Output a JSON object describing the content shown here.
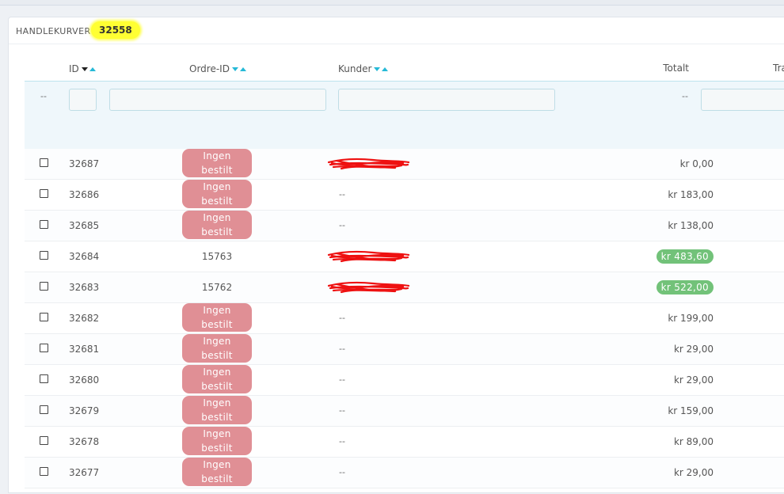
{
  "panel": {
    "title": "HANDLEKURVER",
    "count": "32558"
  },
  "columns": {
    "id": "ID",
    "order_id": "Ordre-ID",
    "customer": "Kunder",
    "total": "Totalt",
    "carrier_partial": "Tra"
  },
  "filters": {
    "bulk_placeholder": "--",
    "total_placeholder": "--",
    "id_value": "",
    "order_value": "",
    "customer_value": "",
    "carrier_value": ""
  },
  "rows": [
    {
      "id": "32687",
      "order": "Ingen bestilt",
      "order_is_badge": true,
      "customer": "",
      "customer_redacted": true,
      "total": "kr 0,00",
      "total_is_badge": false
    },
    {
      "id": "32686",
      "order": "Ingen bestilt",
      "order_is_badge": true,
      "customer": "--",
      "customer_redacted": false,
      "total": "kr 183,00",
      "total_is_badge": false
    },
    {
      "id": "32685",
      "order": "Ingen bestilt",
      "order_is_badge": true,
      "customer": "--",
      "customer_redacted": false,
      "total": "kr 138,00",
      "total_is_badge": false
    },
    {
      "id": "32684",
      "order": "15763",
      "order_is_badge": false,
      "customer": "",
      "customer_redacted": true,
      "total": "kr 483,60",
      "total_is_badge": true
    },
    {
      "id": "32683",
      "order": "15762",
      "order_is_badge": false,
      "customer": "",
      "customer_redacted": true,
      "total": "kr 522,00",
      "total_is_badge": true
    },
    {
      "id": "32682",
      "order": "Ingen bestilt",
      "order_is_badge": true,
      "customer": "--",
      "customer_redacted": false,
      "total": "kr 199,00",
      "total_is_badge": false
    },
    {
      "id": "32681",
      "order": "Ingen bestilt",
      "order_is_badge": true,
      "customer": "--",
      "customer_redacted": false,
      "total": "kr 29,00",
      "total_is_badge": false
    },
    {
      "id": "32680",
      "order": "Ingen bestilt",
      "order_is_badge": true,
      "customer": "--",
      "customer_redacted": false,
      "total": "kr 29,00",
      "total_is_badge": false
    },
    {
      "id": "32679",
      "order": "Ingen bestilt",
      "order_is_badge": true,
      "customer": "--",
      "customer_redacted": false,
      "total": "kr 159,00",
      "total_is_badge": false
    },
    {
      "id": "32678",
      "order": "Ingen bestilt",
      "order_is_badge": true,
      "customer": "--",
      "customer_redacted": false,
      "total": "kr 89,00",
      "total_is_badge": false
    },
    {
      "id": "32677",
      "order": "Ingen bestilt",
      "order_is_badge": true,
      "customer": "--",
      "customer_redacted": false,
      "total": "kr 29,00",
      "total_is_badge": false
    }
  ],
  "colors": {
    "accent": "#25b9d7",
    "badge_red": "#e08f95",
    "badge_green": "#72c279",
    "highlight": "#ffff33",
    "redaction": "#ee1111"
  },
  "icons": {
    "sort_desc": "sort-desc-icon",
    "sort_asc": "sort-asc-icon",
    "redaction": "redaction-scribble"
  }
}
